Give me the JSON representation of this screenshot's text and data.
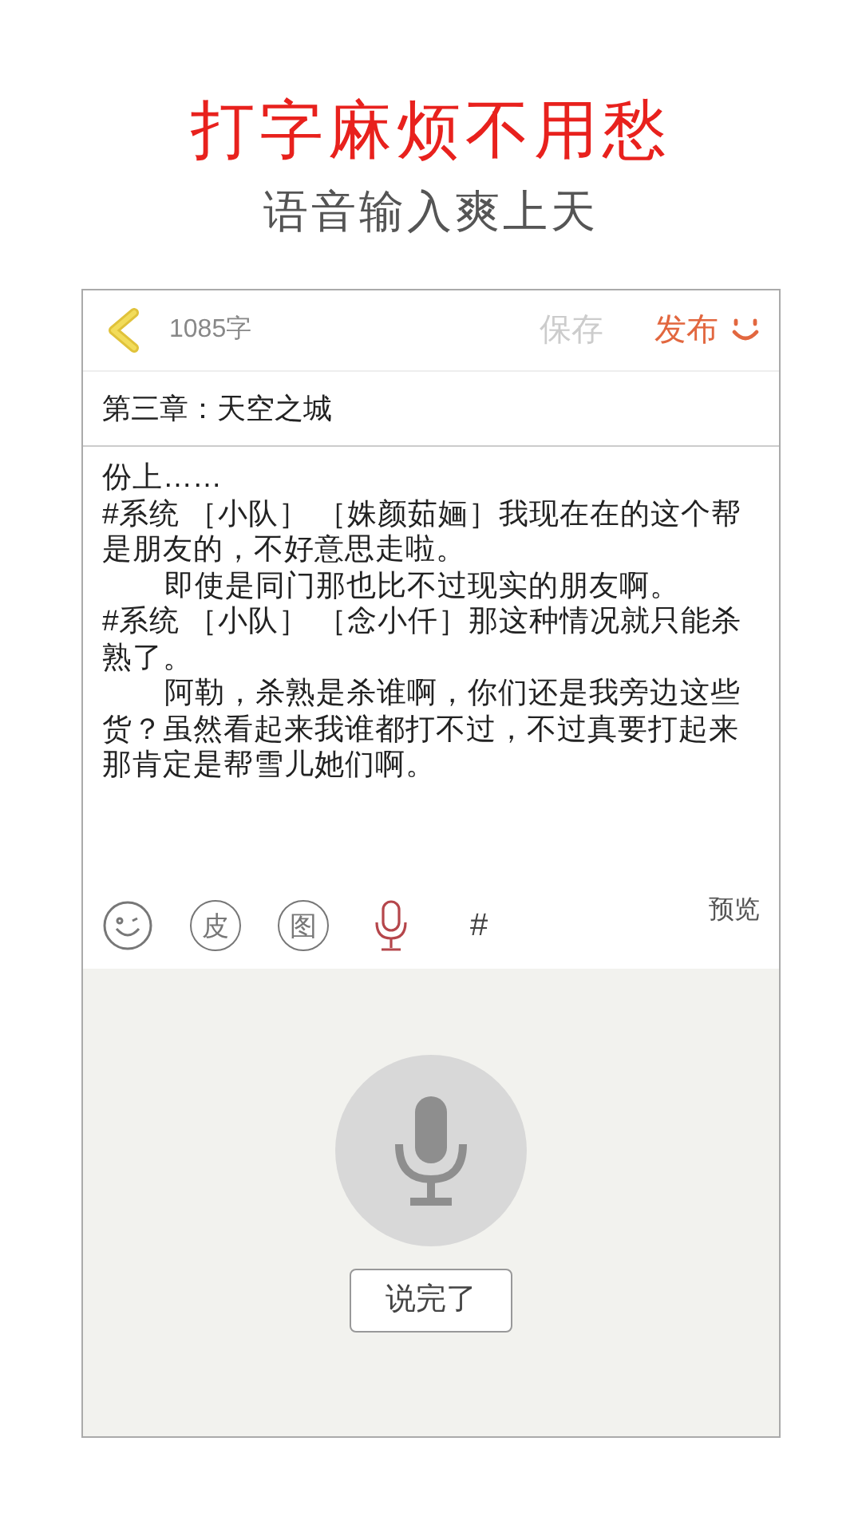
{
  "headline": "打字麻烦不用愁",
  "subheadline": "语音输入爽上天",
  "editor": {
    "word_count": "1085字",
    "save": {
      "label": "保存",
      "disabled": true
    },
    "publish": {
      "label": "发布"
    },
    "chapter_title": "第三章：天空之城",
    "paragraphs": [
      {
        "text": "份上……",
        "indent": false
      },
      {
        "text": "#系统 ［小队］ ［姝颜茹婳］我现在在的这个帮是朋友的，不好意思走啦。",
        "indent": false
      },
      {
        "text": "即使是同门那也比不过现实的朋友啊。",
        "indent": true
      },
      {
        "text": "#系统 ［小队］ ［念小仟］那这种情况就只能杀熟了。",
        "indent": false
      },
      {
        "text": "阿勒，杀熟是杀谁啊，你们还是我旁边这些货？虽然看起来我谁都打不过，不过真要打起来那肯定是帮雪儿她们啊。",
        "indent": true
      }
    ],
    "toolbar": [
      {
        "kind": "emoji",
        "selected": false
      },
      {
        "kind": "circle-text",
        "label": "皮",
        "selected": false
      },
      {
        "kind": "circle-text",
        "label": "图",
        "selected": false
      },
      {
        "kind": "mic",
        "selected": true
      },
      {
        "kind": "text",
        "label": "#",
        "selected": false
      }
    ],
    "preview": "预览",
    "voice": {
      "done_button": "说完了"
    }
  }
}
